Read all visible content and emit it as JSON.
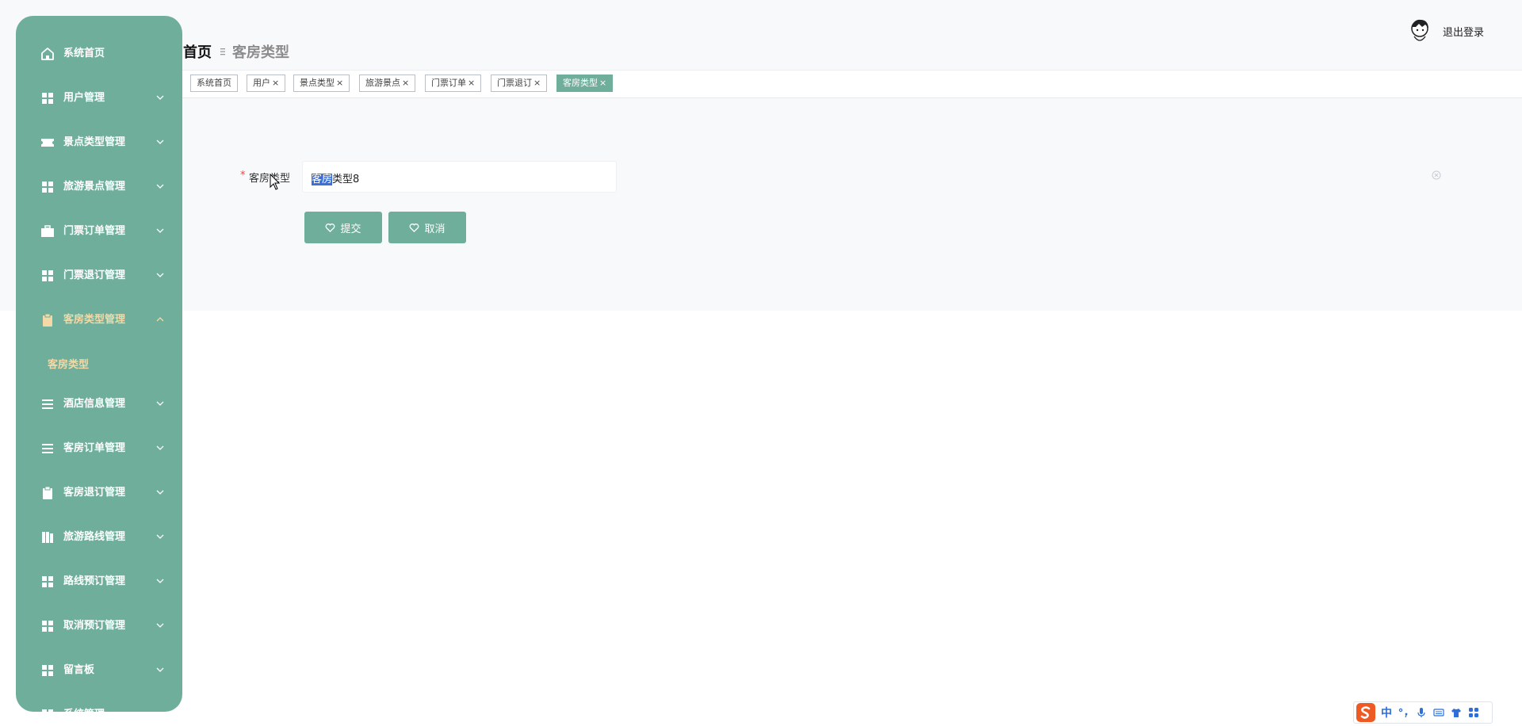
{
  "sidebar": {
    "items": [
      {
        "label": "系统首页",
        "icon": "home-icon"
      },
      {
        "label": "用户管理",
        "icon": "grid-icon"
      },
      {
        "label": "景点类型管理",
        "icon": "ticket-icon"
      },
      {
        "label": "旅游景点管理",
        "icon": "grid-icon"
      },
      {
        "label": "门票订单管理",
        "icon": "briefcase-icon"
      },
      {
        "label": "门票退订管理",
        "icon": "grid-icon"
      },
      {
        "label": "客房类型管理",
        "icon": "clipboard-icon"
      },
      {
        "label": "酒店信息管理",
        "icon": "list-icon"
      },
      {
        "label": "客房订单管理",
        "icon": "list-icon"
      },
      {
        "label": "客房退订管理",
        "icon": "clipboard-icon"
      },
      {
        "label": "旅游路线管理",
        "icon": "book-icon"
      },
      {
        "label": "路线预订管理",
        "icon": "grid-icon"
      },
      {
        "label": "取消预订管理",
        "icon": "grid-icon"
      },
      {
        "label": "留言板",
        "icon": "grid-icon"
      },
      {
        "label": "系统管理",
        "icon": "grid-icon"
      }
    ],
    "sub_items": [
      {
        "label": "客房类型"
      }
    ]
  },
  "breadcrumb": {
    "home": "首页",
    "current": "客房类型"
  },
  "header": {
    "logout": "退出登录"
  },
  "tags": [
    {
      "label": "系统首页",
      "closable": false,
      "active": false
    },
    {
      "label": "用户",
      "closable": true,
      "active": false
    },
    {
      "label": "景点类型",
      "closable": true,
      "active": false
    },
    {
      "label": "旅游景点",
      "closable": true,
      "active": false
    },
    {
      "label": "门票订单",
      "closable": true,
      "active": false
    },
    {
      "label": "门票退订",
      "closable": true,
      "active": false
    },
    {
      "label": "客房类型",
      "closable": true,
      "active": true
    }
  ],
  "tag_close_glyph": "×",
  "form": {
    "required_mark": "*",
    "label": "客房类型",
    "value_selected": "客房",
    "value_rest": "类型8"
  },
  "buttons": {
    "submit": "提交",
    "cancel": "取消"
  },
  "ime": {
    "lang": "中"
  },
  "colors": {
    "sidebar_bg": "#6fae9a",
    "accent": "#6fae9a",
    "submenu_text": "#f4d9a6",
    "required": "#e04b4b",
    "selection": "#3b6fd6"
  }
}
